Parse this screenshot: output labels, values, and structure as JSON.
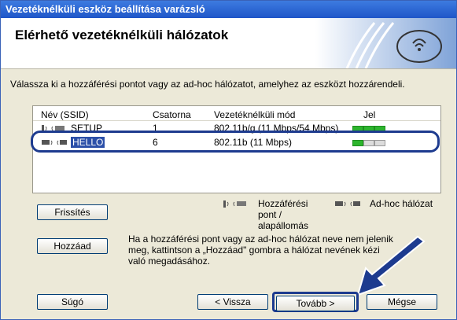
{
  "window": {
    "title": "Vezetéknélküli eszköz beállítása varázsló"
  },
  "header": {
    "title": "Elérhető vezetéknélküli hálózatok"
  },
  "intro": "Válassza ki a hozzáférési pontot vagy az ad-hoc hálózatot, amelyhez az eszközt hozzárendeli.",
  "table": {
    "columns": {
      "ssid": "Név (SSID)",
      "channel": "Csatorna",
      "mode": "Vezetéknélküli mód",
      "signal": "Jel"
    },
    "rows": [
      {
        "ssid": "SETUP",
        "channel": "1",
        "mode": "802.11b/g (11 Mbps/54 Mbps)",
        "signal_bars_filled": 3,
        "type": "access-point",
        "selected": false
      },
      {
        "ssid": "HELLO",
        "channel": "6",
        "mode": "802.11b (11 Mbps)",
        "signal_bars_filled": 1,
        "type": "ad-hoc",
        "selected": true
      }
    ]
  },
  "legend": {
    "access_point_lines": [
      "Hozzáférési",
      "pont /",
      "alapállomás"
    ],
    "adhoc": "Ad-hoc hálózat"
  },
  "buttons": {
    "refresh": "Frissítés",
    "add": "Hozzáad",
    "help": "Súgó",
    "back": "< Vissza",
    "next": "Tovább >",
    "cancel": "Mégse"
  },
  "info_lines": [
    "Ha a hozzáférési pont vagy az ad-hoc hálózat neve nem jelenik",
    "meg, kattintson a „Hozzáad\" gombra a hálózat nevének kézi",
    "való megadásához."
  ],
  "colors": {
    "accent": "#1d3b8f",
    "titlebar": "#2a63d2",
    "signal_on": "#2db52d"
  }
}
